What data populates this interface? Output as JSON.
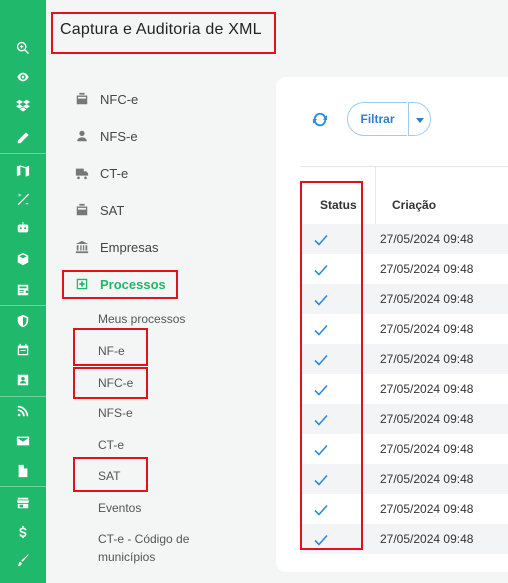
{
  "header": {
    "title": "Captura e Auditoria de XML"
  },
  "rail": {
    "icons": [
      "zoom-in-icon",
      "eye-icon",
      "dropbox-icon",
      "pencil-icon",
      "map-icon",
      "stats-icon",
      "robot-icon",
      "box-icon",
      "certificate-icon",
      "shield-icon",
      "calendar-icon",
      "badge-icon",
      "rss-icon",
      "mail-icon",
      "file-icon",
      "store-icon",
      "dollar-icon",
      "brush-icon"
    ]
  },
  "menu": {
    "items": [
      {
        "label": "NFC-e",
        "icon": "register-icon"
      },
      {
        "label": "NFS-e",
        "icon": "person-icon"
      },
      {
        "label": "CT-e",
        "icon": "truck-icon"
      },
      {
        "label": "SAT",
        "icon": "register-icon"
      },
      {
        "label": "Empresas",
        "icon": "bank-icon"
      },
      {
        "label": "Processos",
        "icon": "medical-box-icon",
        "active": true
      }
    ],
    "subitems": [
      "Meus processos",
      "NF-e",
      "NFC-e",
      "NFS-e",
      "CT-e",
      "SAT",
      "Eventos",
      "CT-e - Código de",
      "municípios"
    ]
  },
  "toolbar": {
    "filter_label": "Filtrar"
  },
  "table": {
    "columns": [
      "Status",
      "Criação"
    ],
    "rows": [
      {
        "status": "ok",
        "created": "27/05/2024 09:48"
      },
      {
        "status": "ok",
        "created": "27/05/2024 09:48"
      },
      {
        "status": "ok",
        "created": "27/05/2024 09:48"
      },
      {
        "status": "ok",
        "created": "27/05/2024 09:48"
      },
      {
        "status": "ok",
        "created": "27/05/2024 09:48"
      },
      {
        "status": "ok",
        "created": "27/05/2024 09:48"
      },
      {
        "status": "ok",
        "created": "27/05/2024 09:48"
      },
      {
        "status": "ok",
        "created": "27/05/2024 09:48"
      },
      {
        "status": "ok",
        "created": "27/05/2024 09:48"
      },
      {
        "status": "ok",
        "created": "27/05/2024 09:48"
      },
      {
        "status": "ok",
        "created": "27/05/2024 09:48"
      }
    ]
  },
  "colors": {
    "accent": "#20b86a",
    "link": "#2b8be0",
    "highlight": "#e0121b"
  }
}
